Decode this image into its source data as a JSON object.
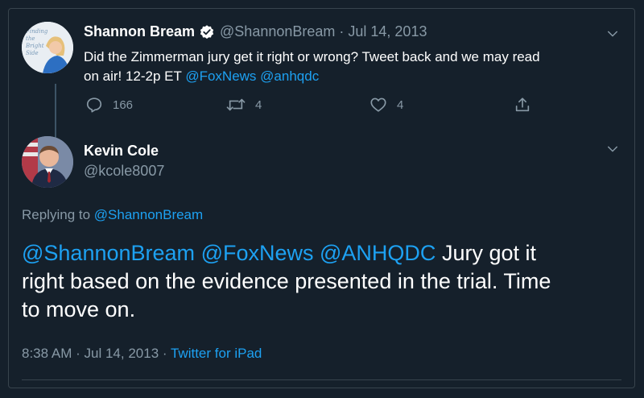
{
  "original_tweet": {
    "author_name": "Shannon Bream",
    "handle": "@ShannonBream",
    "separator": "·",
    "date": "Jul 14, 2013",
    "text_part1": "Did the Zimmerman jury get it right or wrong?  Tweet back and we may read",
    "text_part2": "on air! 12-2p ET ",
    "mention1": "@FoxNews",
    "mention2": "@anhqdc",
    "replies": "166",
    "retweets": "4",
    "likes": "4",
    "avatar_book_text": "Finding the Bright Side"
  },
  "reply_tweet": {
    "author_name": "Kevin Cole",
    "handle": "@kcole8007",
    "replying_to_label": "Replying to ",
    "replying_to_handle": "@ShannonBream",
    "mention1": "@ShannonBream",
    "mention2": "@FoxNews",
    "mention3": "@ANHQDC",
    "text_part1": " Jury got it",
    "text_part2": "right based on the evidence presented in the trial.  Time",
    "text_part3": "to move on.",
    "time": "8:38 AM",
    "separator": "·",
    "date": "Jul 14, 2013",
    "separator2": "·",
    "source": "Twitter for iPad"
  },
  "colors": {
    "background": "#15202b",
    "link": "#1da1f2",
    "muted": "#8899a6",
    "verified_badge": "#ffffff"
  },
  "icons": [
    "verified-badge-icon",
    "chevron-down-icon",
    "reply-icon",
    "retweet-icon",
    "like-icon",
    "share-icon"
  ]
}
